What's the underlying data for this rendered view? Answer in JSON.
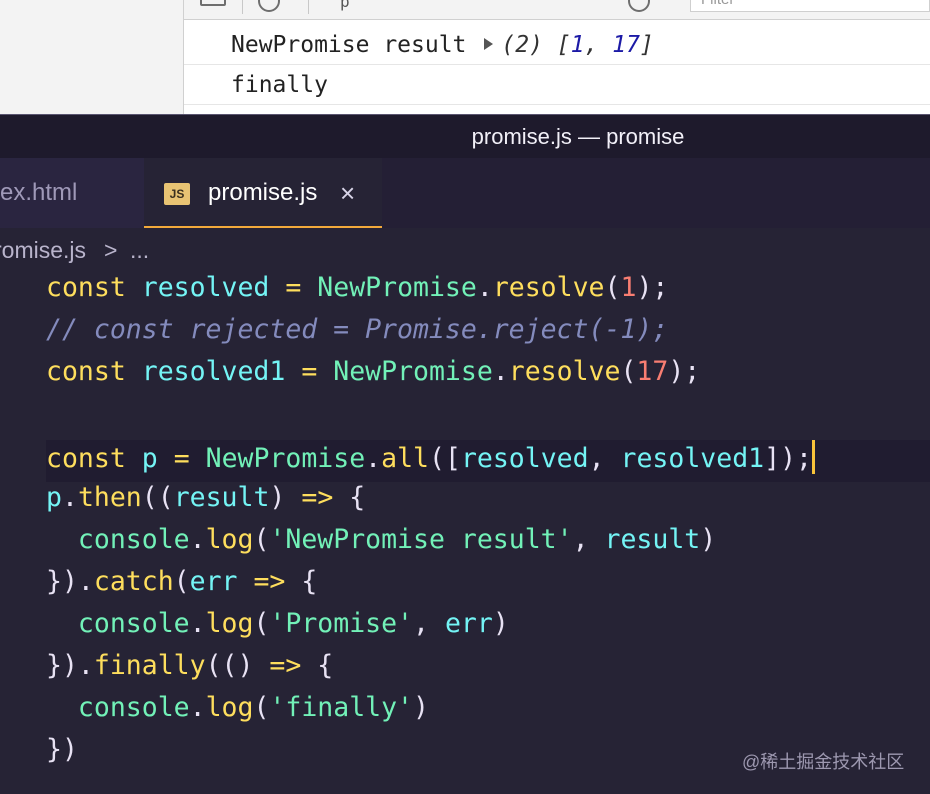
{
  "console": {
    "toolbar_fragment": "p",
    "filter_placeholder": "Filter",
    "messages": [
      {
        "label": "NewPromise result",
        "array_head": "(2)",
        "array_open": " [",
        "array_values": [
          "1",
          "17"
        ],
        "array_close": "]"
      },
      {
        "label": "finally"
      }
    ]
  },
  "window": {
    "title": "promise.js — promise"
  },
  "tabs": [
    {
      "label": "ex.html",
      "active": false
    },
    {
      "label": "promise.js",
      "active": true,
      "badge": "JS",
      "close_glyph": "×"
    }
  ],
  "breadcrumb": {
    "file": "romise.js",
    "separator": ">",
    "more": "..."
  },
  "code": {
    "l1": {
      "kw": "const",
      "var": "resolved",
      "eq": "=",
      "obj": "NewPromise",
      "dot": ".",
      "fn": "resolve",
      "open": "(",
      "num": "1",
      "close": ");"
    },
    "l2": {
      "comment": "// const rejected = Promise.reject(-1);"
    },
    "l3": {
      "kw": "const",
      "var": "resolved1",
      "eq": "=",
      "obj": "NewPromise",
      "dot": ".",
      "fn": "resolve",
      "open": "(",
      "num": "17",
      "close": ");"
    },
    "l5": {
      "kw": "const",
      "var": "p",
      "eq": "=",
      "obj": "NewPromise",
      "dot": ".",
      "fn": "all",
      "open": "([",
      "a1": "resolved",
      "comma": ",",
      "a2": "resolved1",
      "close": "]);"
    },
    "l6": {
      "p": "p",
      "dot": ".",
      "fn": "then",
      "open": "((",
      "param": "result",
      "close": ")",
      "arrow": "=>",
      "brace": "{"
    },
    "l7": {
      "obj": "console",
      "dot": ".",
      "fn": "log",
      "open": "(",
      "str": "'NewPromise result'",
      "comma": ",",
      "arg": "result",
      "close": ")"
    },
    "l8": {
      "close": "}).",
      "fn": "catch",
      "open": "(",
      "param": "err",
      "arrow": "=>",
      "brace": "{"
    },
    "l9": {
      "obj": "console",
      "dot": ".",
      "fn": "log",
      "open": "(",
      "str": "'Promise'",
      "comma": ",",
      "arg": "err",
      "close": ")"
    },
    "l10": {
      "close": "}).",
      "fn": "finally",
      "open": "(()",
      "arrow": "=>",
      "brace": "{"
    },
    "l11": {
      "obj": "console",
      "dot": ".",
      "fn": "log",
      "open": "(",
      "str": "'finally'",
      "close": ")"
    },
    "l12": {
      "close": "})"
    }
  },
  "watermark": "@稀土掘金技术社区",
  "colors": {
    "editor_bg": "#262335",
    "keyword": "#fede5d",
    "variable": "#74f4f5",
    "number": "#f97e72",
    "string": "#ff8b39",
    "comment": "#848bbd",
    "object": "#72f1b8",
    "tab_accent": "#f2a93b"
  }
}
